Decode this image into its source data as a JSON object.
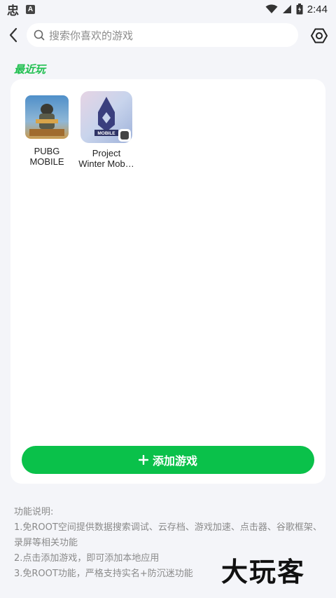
{
  "status_bar": {
    "time": "2:44",
    "left_icons": [
      "app-notification-icon",
      "a-icon"
    ],
    "right_icons": [
      "wifi-icon",
      "signal-icon",
      "battery-icon"
    ]
  },
  "search": {
    "placeholder": "搜索你喜欢的游戏"
  },
  "recent": {
    "title": "最近玩",
    "games": [
      {
        "name": "PUBG\nMOBILE",
        "icon": "pubg-mobile-icon"
      },
      {
        "name": "Project\nWinter Mob…",
        "icon": "project-winter-icon"
      }
    ]
  },
  "add_button": {
    "label": "添加游戏"
  },
  "description": {
    "heading": "功能说明:",
    "lines": [
      "1.免ROOT空间提供数据搜索调试、云存档、游戏加速、点击器、谷歌框架、录屏等相关功能",
      "2.点击添加游戏，即可添加本地应用",
      "3.免ROOT功能，严格支持实名+防沉迷功能"
    ]
  },
  "watermark": "大玩客",
  "colors": {
    "accent": "#0ac14a",
    "title_green": "#1fbf4f",
    "background": "#f4f5f9"
  }
}
